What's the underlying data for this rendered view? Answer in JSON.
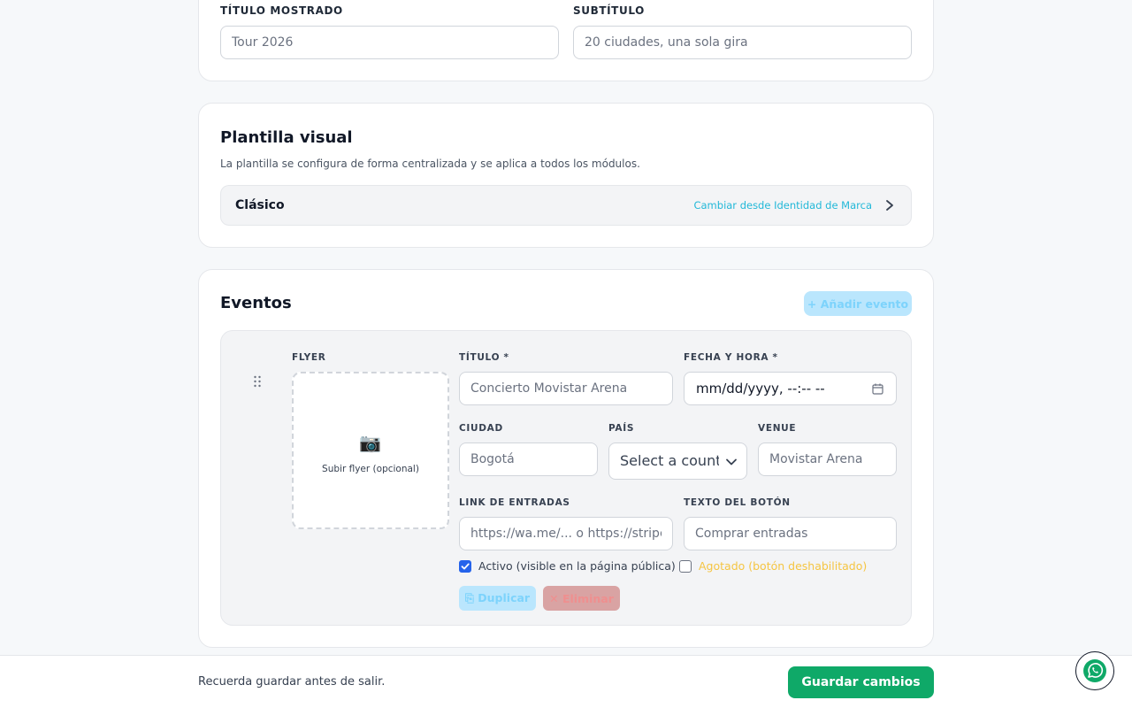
{
  "header_card": {
    "title_label": "TÍTULO MOSTRADO",
    "title_value": "Tour 2026",
    "subtitle_label": "SUBTÍTULO",
    "subtitle_value": "20 ciudades, una sola gira"
  },
  "template_card": {
    "heading": "Plantilla visual",
    "description": "La plantilla se configura de forma centralizada y se aplica a todos los módulos.",
    "current_template": "Clásico",
    "change_link": "Cambiar desde Identidad de Marca"
  },
  "events_card": {
    "heading": "Eventos",
    "add_button": "+ Añadir evento",
    "event": {
      "flyer_label": "FLYER",
      "flyer_upload_text": "Subir flyer (opcional)",
      "title_label": "TÍTULO *",
      "title_placeholder": "Concierto Movistar Arena",
      "datetime_label": "FECHA Y HORA *",
      "datetime_placeholder": "mm/dd/yyyy, --:-- --",
      "city_label": "CIUDAD",
      "city_placeholder": "Bogotá",
      "country_label": "PAÍS",
      "country_value": "Select a country",
      "venue_label": "VENUE",
      "venue_placeholder": "Movistar Arena",
      "tickets_label": "LINK DE ENTRADAS",
      "tickets_placeholder": "https://wa.me/... o https://stripe.com/...",
      "button_text_label": "TEXTO DEL BOTÓN",
      "button_text_placeholder": "Comprar entradas",
      "active_label": "Activo (visible en la página pública)",
      "active_checked": true,
      "soldout_label": "Agotado (botón deshabilitado)",
      "soldout_checked": false,
      "duplicate_button": "⎘ Duplicar",
      "delete_button": "✕ Eliminar"
    }
  },
  "footer": {
    "message": "Recuerda guardar antes de salir.",
    "save_button": "Guardar cambios"
  },
  "colors": {
    "accent": "#22b8d8",
    "save": "#0fa968",
    "soldout": "#f5c542"
  }
}
